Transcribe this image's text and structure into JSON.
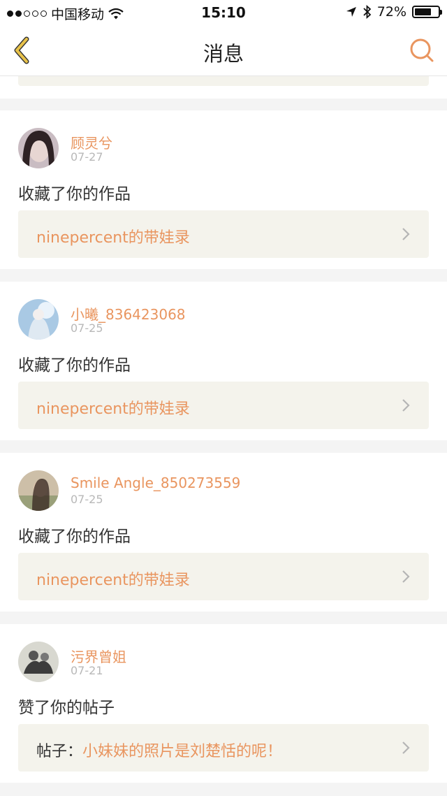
{
  "status_bar": {
    "carrier": "中国移动",
    "time": "15:10",
    "battery_text": "72%",
    "battery_level": 0.72,
    "signal_icon": "signal-dots-icon",
    "wifi_icon": "wifi-icon",
    "location_icon": "location-arrow-icon",
    "bluetooth_icon": "bluetooth-icon"
  },
  "nav": {
    "title": "消息",
    "back_icon": "chevron-left-icon",
    "search_icon": "search-icon"
  },
  "colors": {
    "accent": "#e9955f",
    "back_icon_color": "#e8c24a",
    "link_bg": "#f4f3ec",
    "page_bg": "#f4f4f4"
  },
  "messages": [
    {
      "user": "顾灵兮",
      "date": "07-27",
      "action": "收藏了你的作品",
      "link_prefix": "",
      "link_text": "ninepercent的带娃录"
    },
    {
      "user": "小曦_836423068",
      "date": "07-25",
      "action": "收藏了你的作品",
      "link_prefix": "",
      "link_text": "ninepercent的带娃录"
    },
    {
      "user": "Smile Angle_850273559",
      "date": "07-25",
      "action": "收藏了你的作品",
      "link_prefix": "",
      "link_text": "ninepercent的带娃录"
    },
    {
      "user": "污界曾姐",
      "date": "07-21",
      "action": "赞了你的帖子",
      "link_prefix": "帖子：",
      "link_text": "小妹妹的照片是刘楚恬的呢！"
    }
  ]
}
